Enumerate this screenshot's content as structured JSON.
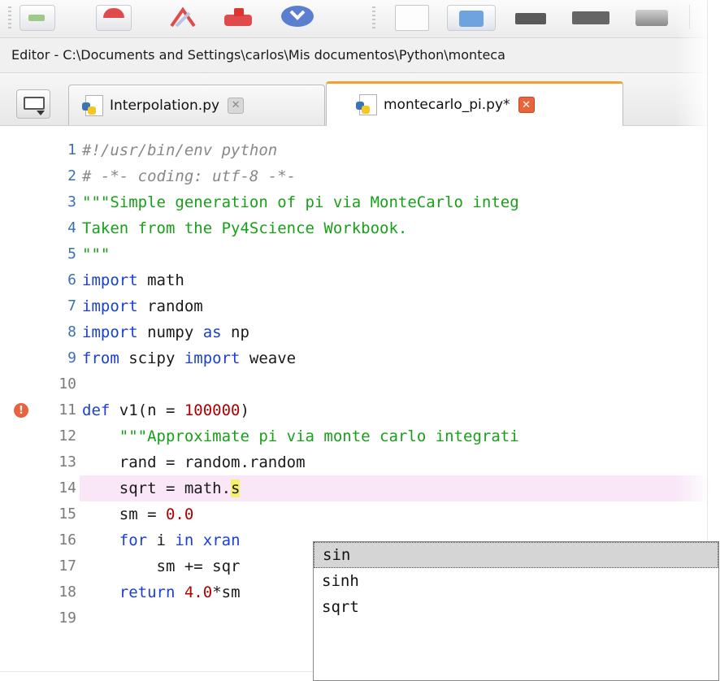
{
  "window": {
    "title": "Editor - C:\\Documents and Settings\\carlos\\Mis documentos\\Python\\monteca"
  },
  "tabs": [
    {
      "label": "Interpolation.py",
      "active": false,
      "close_icon": "close-icon"
    },
    {
      "label": "montecarlo_pi.py*",
      "active": true,
      "close_icon": "close-icon"
    }
  ],
  "editor": {
    "current_line": 14,
    "error_line": 11,
    "lines": [
      {
        "num": "1",
        "segments": [
          {
            "t": "cm",
            "v": "#!/usr/bin/env python"
          }
        ]
      },
      {
        "num": "2",
        "segments": [
          {
            "t": "cm",
            "v": "# -*- coding: utf-8 -*-"
          }
        ]
      },
      {
        "num": "3",
        "segments": [
          {
            "t": "st",
            "v": "\"\"\"Simple generation of pi via MonteCarlo integ"
          }
        ]
      },
      {
        "num": "4",
        "segments": [
          {
            "t": "st",
            "v": "Taken from the Py4Science Workbook."
          }
        ]
      },
      {
        "num": "5",
        "segments": [
          {
            "t": "st",
            "v": "\"\"\""
          }
        ]
      },
      {
        "num": "6",
        "segments": [
          {
            "t": "kw",
            "v": "import"
          },
          {
            "t": "",
            "v": " math"
          }
        ]
      },
      {
        "num": "7",
        "segments": [
          {
            "t": "kw",
            "v": "import"
          },
          {
            "t": "",
            "v": " random"
          }
        ]
      },
      {
        "num": "8",
        "segments": [
          {
            "t": "kw",
            "v": "import"
          },
          {
            "t": "",
            "v": " numpy "
          },
          {
            "t": "kw",
            "v": "as"
          },
          {
            "t": "",
            "v": " np"
          }
        ]
      },
      {
        "num": "9",
        "segments": [
          {
            "t": "kw",
            "v": "from"
          },
          {
            "t": "",
            "v": " scipy "
          },
          {
            "t": "kw",
            "v": "import"
          },
          {
            "t": "",
            "v": " weave"
          }
        ]
      },
      {
        "num": "10",
        "segments": []
      },
      {
        "num": "11",
        "segments": [
          {
            "t": "kw",
            "v": "def"
          },
          {
            "t": "",
            "v": " v1(n = "
          },
          {
            "t": "nm",
            "v": "100000"
          },
          {
            "t": "",
            "v": ")"
          }
        ]
      },
      {
        "num": "12",
        "segments": [
          {
            "t": "",
            "v": "    "
          },
          {
            "t": "st",
            "v": "\"\"\"Approximate pi via monte carlo integrati"
          }
        ]
      },
      {
        "num": "13",
        "segments": [
          {
            "t": "",
            "v": "    rand = random.random"
          }
        ]
      },
      {
        "num": "14",
        "segments": [
          {
            "t": "",
            "v": "    sqrt = math."
          },
          {
            "t": "cursor",
            "v": "s"
          }
        ]
      },
      {
        "num": "15",
        "segments": [
          {
            "t": "",
            "v": "    sm = "
          },
          {
            "t": "nm",
            "v": "0.0"
          }
        ]
      },
      {
        "num": "16",
        "segments": [
          {
            "t": "",
            "v": "    "
          },
          {
            "t": "kw",
            "v": "for"
          },
          {
            "t": "",
            "v": " i "
          },
          {
            "t": "kw",
            "v": "in"
          },
          {
            "t": "",
            "v": " "
          },
          {
            "t": "kw",
            "v": "xran"
          }
        ]
      },
      {
        "num": "17",
        "segments": [
          {
            "t": "",
            "v": "        sm += sqr"
          }
        ]
      },
      {
        "num": "18",
        "segments": [
          {
            "t": "",
            "v": "    "
          },
          {
            "t": "kw",
            "v": "return"
          },
          {
            "t": "",
            "v": " "
          },
          {
            "t": "nm",
            "v": "4.0"
          },
          {
            "t": "",
            "v": "*sm"
          }
        ]
      },
      {
        "num": "19",
        "segments": []
      }
    ]
  },
  "completion": {
    "items": [
      "sin",
      "sinh",
      "sqrt"
    ],
    "selected": 0
  }
}
